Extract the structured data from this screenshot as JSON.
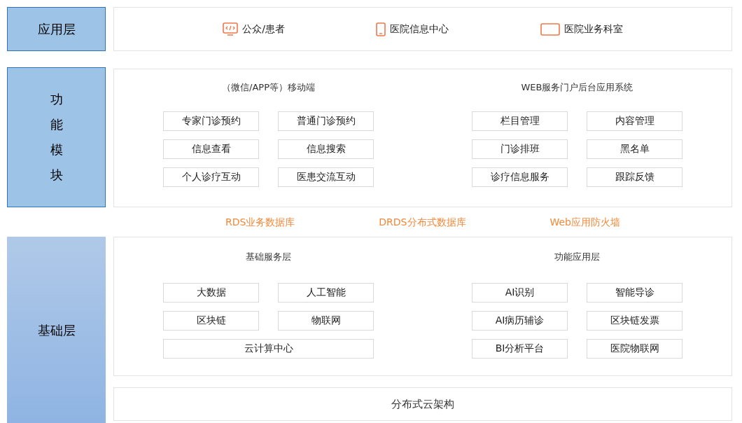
{
  "app_layer": {
    "label": "应用层",
    "items": [
      {
        "kind": "monitor",
        "label": "公众/患者"
      },
      {
        "kind": "tablet",
        "label": "医院信息中心"
      },
      {
        "kind": "screen",
        "label": "医院业务科室"
      }
    ]
  },
  "function_layer": {
    "label": "功能模块",
    "groups": [
      {
        "title": "（微信/APP等）移动端",
        "items": [
          {
            "label": "专家门诊预约",
            "wide": false
          },
          {
            "label": "普通门诊预约",
            "wide": false
          },
          {
            "label": "信息查看",
            "wide": false
          },
          {
            "label": "信息搜索",
            "wide": false
          },
          {
            "label": "个人诊疗互动",
            "wide": false
          },
          {
            "label": "医患交流互动",
            "wide": false
          }
        ]
      },
      {
        "title": "WEB服务门户后台应用系统",
        "items": [
          {
            "label": "栏目管理",
            "wide": false
          },
          {
            "label": "内容管理",
            "wide": false
          },
          {
            "label": "门诊排班",
            "wide": false
          },
          {
            "label": "黑名单",
            "wide": false
          },
          {
            "label": "诊疗信息服务",
            "wide": false
          },
          {
            "label": "跟踪反馈",
            "wide": false
          }
        ]
      }
    ]
  },
  "databases": [
    "RDS业务数据库",
    "DRDS分布式数据库",
    "Web应用防火墙"
  ],
  "base_layer": {
    "label": "基础层",
    "groups": [
      {
        "title": "基础服务层",
        "items": [
          {
            "label": "大数据",
            "wide": false
          },
          {
            "label": "人工智能",
            "wide": false
          },
          {
            "label": "区块链",
            "wide": false
          },
          {
            "label": "物联网",
            "wide": false
          },
          {
            "label": "云计算中心",
            "wide": true
          }
        ]
      },
      {
        "title": "功能应用层",
        "items": [
          {
            "label": "AI识别",
            "wide": false
          },
          {
            "label": "智能导诊",
            "wide": false
          },
          {
            "label": "AI病历辅诊",
            "wide": false
          },
          {
            "label": "区块链发票",
            "wide": false
          },
          {
            "label": "BI分析平台",
            "wide": false
          },
          {
            "label": "医院物联网",
            "wide": false
          }
        ]
      }
    ],
    "footer": "分布式云架构"
  }
}
